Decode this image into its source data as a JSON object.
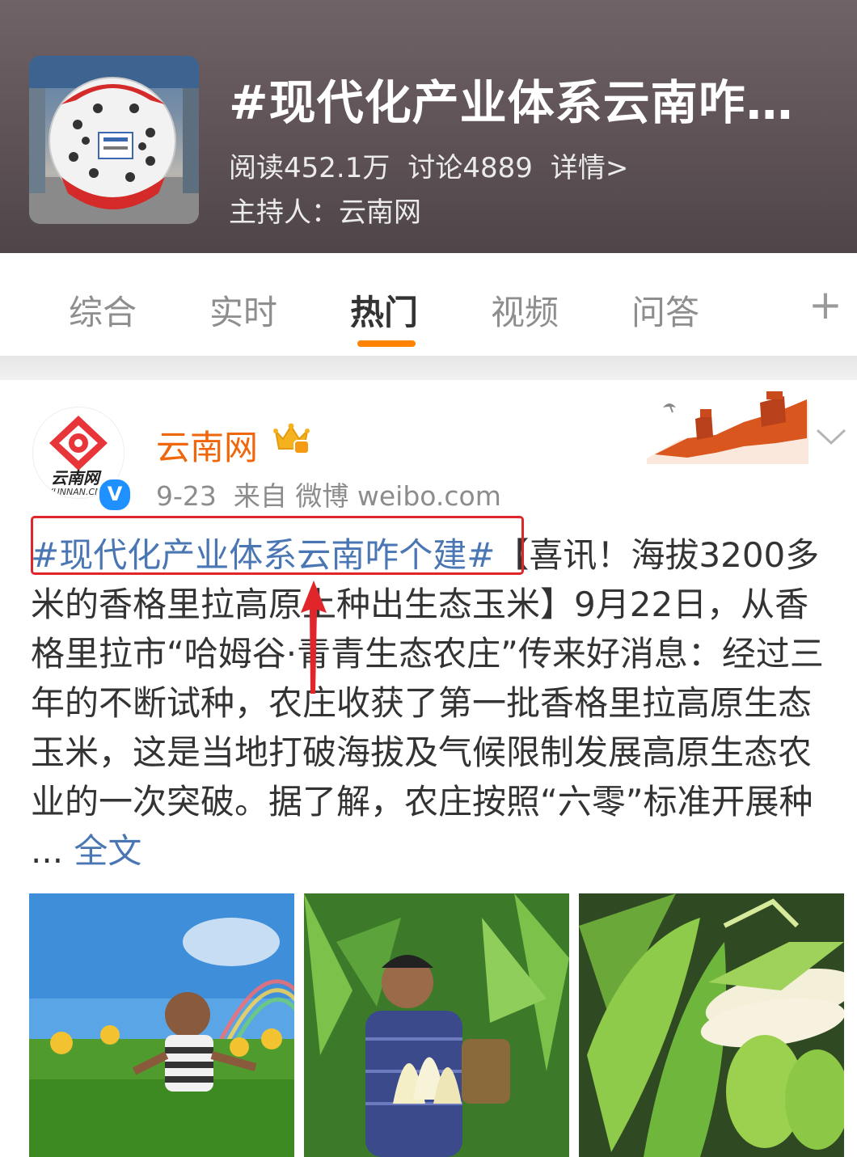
{
  "topic": {
    "title": "#现代化产业体系云南咋个建#",
    "reads": "阅读452.1万",
    "discussions": "讨论4889",
    "details": "详情>",
    "host": "主持人：云南网"
  },
  "tabs": [
    {
      "label": "综合"
    },
    {
      "label": "实时"
    },
    {
      "label": "热门",
      "active": true
    },
    {
      "label": "视频"
    },
    {
      "label": "问答"
    }
  ],
  "tab_add": "+",
  "post": {
    "author": "云南网",
    "avatar_text": "云南网",
    "avatar_subtext": "YUNNAN.CN",
    "verified_mark": "V",
    "date": "9-23",
    "source": "来自 微博 weibo.com",
    "hashtag": "#现代化产业体系云南咋个建#",
    "text": "【喜讯！海拔3200多米的香格里拉高原上种出生态玉米】9月22日，从香格里拉市“哈姆谷·青青生态农庄”传来好消息：经过三年的不断试种，农庄收获了第一批香格里拉高原生态玉米，这是当地打破海拔及气候限制发展高原生态农业的一次突破。据了解，农庄按照“六零”标准开展种 ... ",
    "full_text_link": "全文"
  },
  "colors": {
    "accent": "#ff8200",
    "author": "#f0660a",
    "link": "#4a77b4",
    "annotation": "#e0262a"
  }
}
